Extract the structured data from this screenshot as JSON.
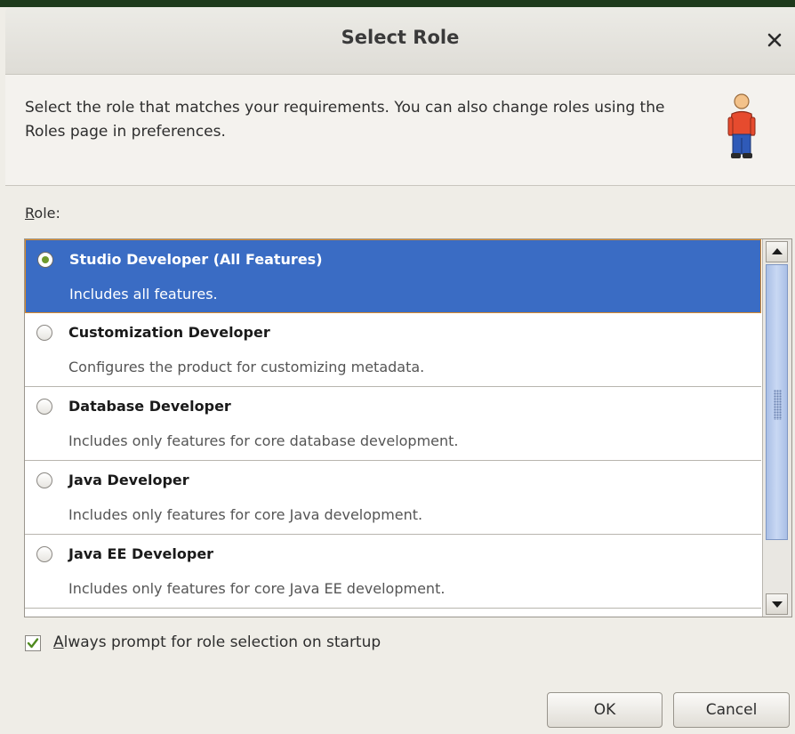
{
  "dialog": {
    "title": "Select Role",
    "close_icon": "close-icon",
    "description": "Select the role that matches your requirements. You can also change roles using the Roles page in preferences.",
    "banner_icon": "person-icon"
  },
  "role_label": {
    "mnemonic": "R",
    "rest": "ole:"
  },
  "roles": [
    {
      "title": "Studio Developer (All Features)",
      "description": "Includes all features.",
      "selected": true
    },
    {
      "title": "Customization Developer",
      "description": "Configures the product for customizing metadata.",
      "selected": false
    },
    {
      "title": "Database Developer",
      "description": "Includes only features for core database development.",
      "selected": false
    },
    {
      "title": "Java Developer",
      "description": "Includes only features for core Java development.",
      "selected": false
    },
    {
      "title": "Java EE Developer",
      "description": "Includes only features for core Java EE development.",
      "selected": false
    }
  ],
  "always_prompt": {
    "mnemonic": "A",
    "rest": "lways prompt for role selection on startup",
    "checked": true
  },
  "buttons": {
    "ok": "OK",
    "cancel": "Cancel"
  },
  "colors": {
    "selection": "#3a6cc4",
    "selection_border": "#d98a2b",
    "radio_dot": "#6e9a2e",
    "check_mark": "#4f8a1f"
  }
}
